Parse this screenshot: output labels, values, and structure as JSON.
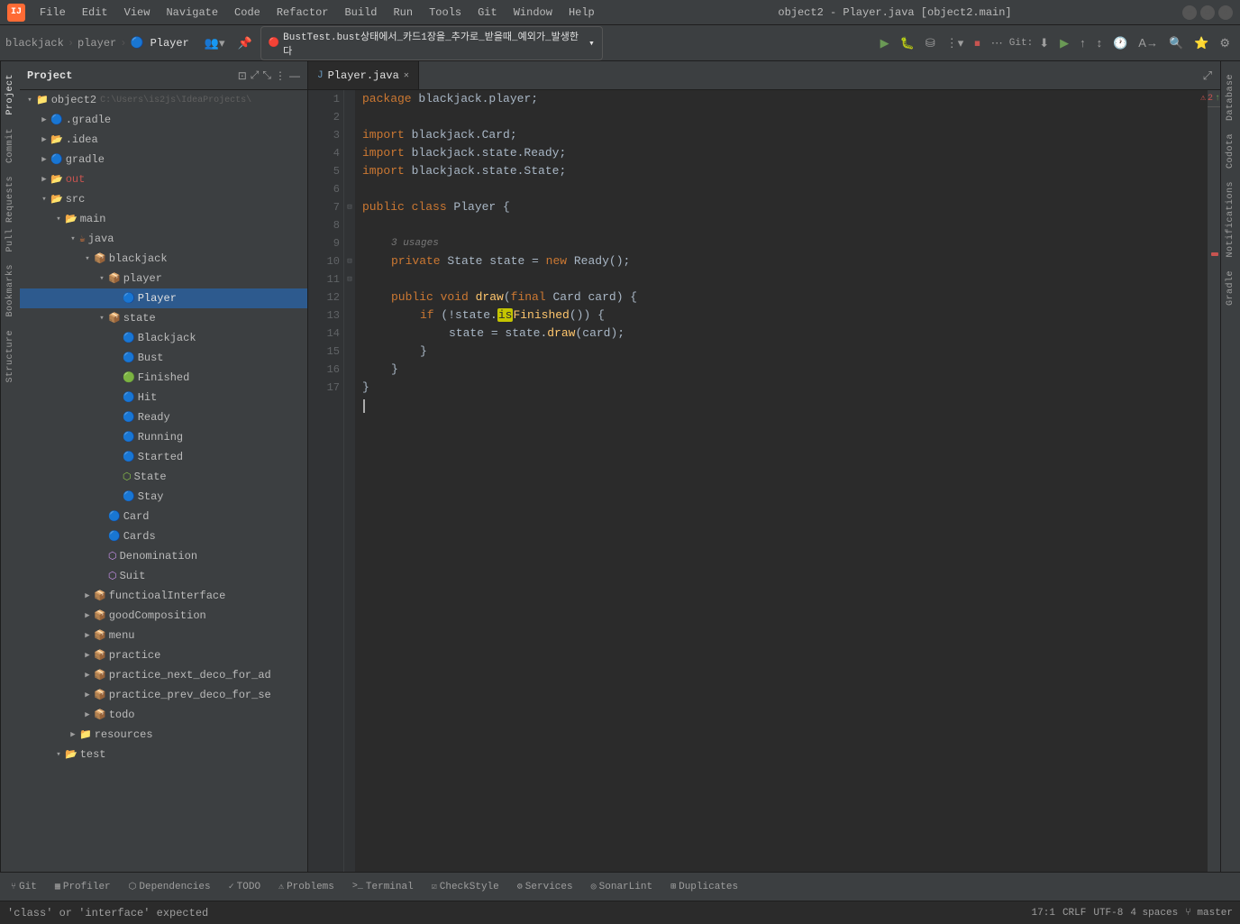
{
  "titlebar": {
    "logo": "IJ",
    "title": "object2 - Player.java [object2.main]",
    "menus": [
      "File",
      "Edit",
      "View",
      "Navigate",
      "Code",
      "Refactor",
      "Build",
      "Run",
      "Tools",
      "Git",
      "Window",
      "Help"
    ],
    "min": "—",
    "max": "□",
    "close": "✕"
  },
  "breadcrumb": {
    "items": [
      "blackjack",
      "player",
      "Player"
    ]
  },
  "run_config": {
    "label": "BustTest.bust상태에서_카드1장을_추가로_받을때_예외가_발생한다"
  },
  "editor": {
    "tab": {
      "label": "Player.java",
      "icon": "J"
    },
    "lines": [
      {
        "num": 1,
        "code": "package blackjack.player;",
        "type": "package"
      },
      {
        "num": 2,
        "code": "",
        "type": "empty"
      },
      {
        "num": 3,
        "code": "import blackjack.Card;",
        "type": "import"
      },
      {
        "num": 4,
        "code": "import blackjack.state.Ready;",
        "type": "import"
      },
      {
        "num": 5,
        "code": "import blackjack.state.State;",
        "type": "import"
      },
      {
        "num": 6,
        "code": "",
        "type": "empty"
      },
      {
        "num": 7,
        "code": "public class Player {",
        "type": "class"
      },
      {
        "num": 8,
        "code": "",
        "type": "empty"
      },
      {
        "num": 9,
        "code": "    private State state = new Ready();",
        "type": "field",
        "usages": "3 usages"
      },
      {
        "num": 10,
        "code": "",
        "type": "empty"
      },
      {
        "num": 11,
        "code": "    public void draw(final Card card) {",
        "type": "method"
      },
      {
        "num": 12,
        "code": "        if (!state.isFinished()) {",
        "type": "code"
      },
      {
        "num": 13,
        "code": "            state = state.draw(card);",
        "type": "code"
      },
      {
        "num": 14,
        "code": "        }",
        "type": "code"
      },
      {
        "num": 15,
        "code": "    }",
        "type": "code"
      },
      {
        "num": 16,
        "code": "}",
        "type": "code"
      },
      {
        "num": 17,
        "code": "",
        "type": "cursor"
      }
    ]
  },
  "project_tree": {
    "title": "Project",
    "root": "object2",
    "root_path": "C:#Users#is2js#IdeaProjects#",
    "items": [
      {
        "id": "gradle",
        "label": ".gradle",
        "type": "folder",
        "depth": 1,
        "collapsed": true
      },
      {
        "id": "idea",
        "label": ".idea",
        "type": "folder",
        "depth": 1,
        "collapsed": true
      },
      {
        "id": "gradle2",
        "label": "gradle",
        "type": "folder",
        "depth": 1,
        "collapsed": true
      },
      {
        "id": "out",
        "label": "out",
        "type": "folder-out",
        "depth": 1,
        "collapsed": true
      },
      {
        "id": "src",
        "label": "src",
        "type": "folder",
        "depth": 1,
        "expanded": true
      },
      {
        "id": "main",
        "label": "main",
        "type": "folder",
        "depth": 2,
        "expanded": true
      },
      {
        "id": "java",
        "label": "java",
        "type": "folder",
        "depth": 3,
        "expanded": true
      },
      {
        "id": "blackjack",
        "label": "blackjack",
        "type": "package",
        "depth": 4,
        "expanded": true
      },
      {
        "id": "player",
        "label": "player",
        "type": "package",
        "depth": 5,
        "expanded": true
      },
      {
        "id": "Player",
        "label": "Player",
        "type": "class",
        "depth": 6,
        "selected": true
      },
      {
        "id": "state",
        "label": "state",
        "type": "package",
        "depth": 5,
        "expanded": true
      },
      {
        "id": "Blackjack",
        "label": "Blackjack",
        "type": "class",
        "depth": 6
      },
      {
        "id": "Bust",
        "label": "Bust",
        "type": "class",
        "depth": 6
      },
      {
        "id": "Finished",
        "label": "Finished",
        "type": "interface",
        "depth": 6
      },
      {
        "id": "Hit",
        "label": "Hit",
        "type": "class",
        "depth": 6
      },
      {
        "id": "Ready",
        "label": "Ready",
        "type": "class",
        "depth": 6
      },
      {
        "id": "Running",
        "label": "Running",
        "type": "class",
        "depth": 6
      },
      {
        "id": "Started",
        "label": "Started",
        "type": "class",
        "depth": 6
      },
      {
        "id": "State",
        "label": "State",
        "type": "interface",
        "depth": 6
      },
      {
        "id": "Stay",
        "label": "Stay",
        "type": "class",
        "depth": 6
      },
      {
        "id": "Card",
        "label": "Card",
        "type": "class",
        "depth": 5
      },
      {
        "id": "Cards",
        "label": "Cards",
        "type": "class",
        "depth": 5
      },
      {
        "id": "Denomination",
        "label": "Denomination",
        "type": "enum",
        "depth": 5
      },
      {
        "id": "Suit",
        "label": "Suit",
        "type": "enum",
        "depth": 5
      },
      {
        "id": "functioalInterface",
        "label": "functioalInterface",
        "type": "package",
        "depth": 4,
        "collapsed": true
      },
      {
        "id": "goodComposition",
        "label": "goodComposition",
        "type": "package",
        "depth": 4,
        "collapsed": true
      },
      {
        "id": "menu",
        "label": "menu",
        "type": "package",
        "depth": 4,
        "collapsed": true
      },
      {
        "id": "practice",
        "label": "practice",
        "type": "package",
        "depth": 4,
        "collapsed": true
      },
      {
        "id": "practice_next_deco_for_ad",
        "label": "practice_next_deco_for_ad",
        "type": "package",
        "depth": 4,
        "collapsed": true
      },
      {
        "id": "practice_prev_deco_for_se",
        "label": "practice_prev_deco_for_se",
        "type": "package",
        "depth": 4,
        "collapsed": true
      },
      {
        "id": "todo",
        "label": "todo",
        "type": "package",
        "depth": 4,
        "collapsed": true
      },
      {
        "id": "resources",
        "label": "resources",
        "type": "folder",
        "depth": 3,
        "collapsed": true
      },
      {
        "id": "test",
        "label": "test",
        "type": "folder",
        "depth": 2,
        "collapsed": true
      }
    ]
  },
  "bottom_tabs": [
    {
      "label": "Git",
      "icon": "⑂"
    },
    {
      "label": "Profiler",
      "icon": "▦"
    },
    {
      "label": "Dependencies",
      "icon": "⬡"
    },
    {
      "label": "TODO",
      "icon": "✓"
    },
    {
      "label": "Problems",
      "icon": "⚠"
    },
    {
      "label": "Terminal",
      "icon": ">_"
    },
    {
      "label": "CheckStyle",
      "icon": "☑"
    },
    {
      "label": "Services",
      "icon": "⚙"
    },
    {
      "label": "SonarLint",
      "icon": "◎"
    },
    {
      "label": "Duplicates",
      "icon": "⊞"
    }
  ],
  "status_bar": {
    "position": "17:1",
    "encoding": "CRLF",
    "charset": "UTF-8",
    "indent": "4 spaces",
    "branch": "master",
    "warning_count": "2",
    "error_text": "'class' or 'interface' expected"
  },
  "right_panels": [
    "Database",
    "Codota",
    "Notifications",
    "Gradle"
  ],
  "left_panels": [
    "Project",
    "Commit",
    "Pull Requests",
    "Bookmarks",
    "Structure"
  ]
}
